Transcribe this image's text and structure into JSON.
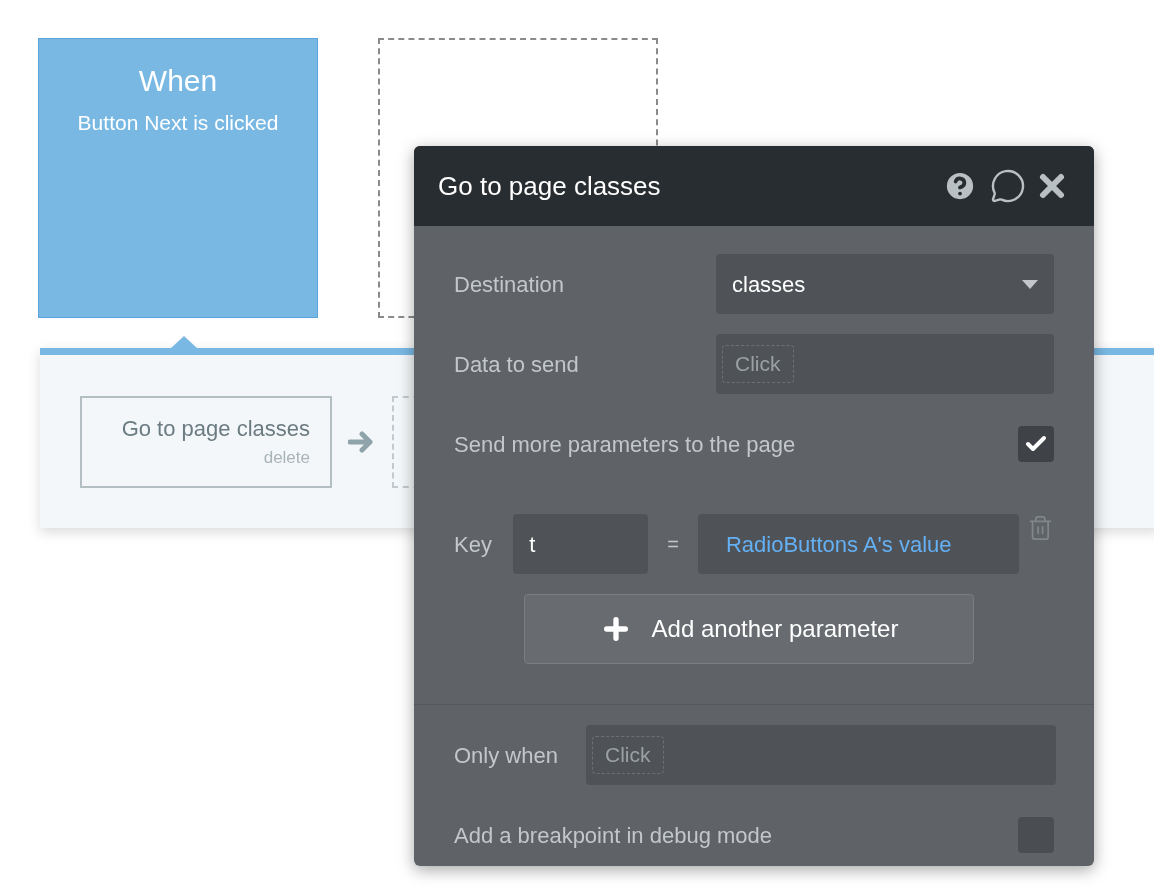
{
  "event": {
    "title": "When",
    "subtitle": "Button Next is clicked"
  },
  "workflow": {
    "actions": [
      {
        "title": "Go to page classes",
        "delete": "delete"
      }
    ]
  },
  "dialog": {
    "title": "Go to page classes",
    "fields": [
      {
        "kind": "dropdown",
        "label": "Destination",
        "value": "classes"
      },
      {
        "kind": "expression",
        "label": "Data to send",
        "placeholder": "Click"
      }
    ],
    "send_more": {
      "label": "Send more parameters to the page",
      "checked": true
    },
    "parameters": [
      {
        "label": "Key",
        "key": "t",
        "operator": "=",
        "value": "RadioButtons A's value"
      }
    ],
    "add_button": "Add another parameter",
    "only_when": {
      "label": "Only when",
      "placeholder": "Click"
    },
    "breakpoint": {
      "label": "Add a breakpoint in debug mode",
      "checked": false
    }
  }
}
